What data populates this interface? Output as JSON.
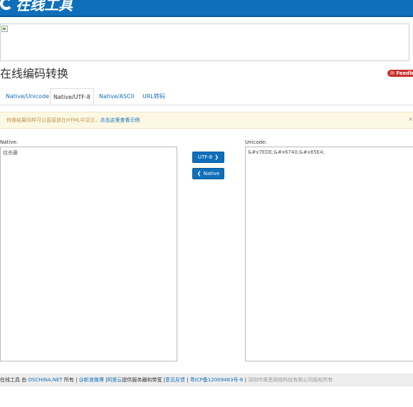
{
  "header": {
    "logo_text": "在线工具"
  },
  "page_title": "在线编码转换",
  "feedback_label": "Feedba",
  "tabs": [
    {
      "label": "Native/Unicode",
      "active": false
    },
    {
      "label": "Native/UTF-8",
      "active": true
    },
    {
      "label": "Native/ASCII",
      "active": false
    },
    {
      "label": "URL转码",
      "active": false
    }
  ],
  "notice": {
    "text": "转换结果同样可以直接放在HTML中显示，",
    "link": "点击这里查看示例",
    "close": "×"
  },
  "native": {
    "label": "Native:",
    "value": "纹杀藤"
  },
  "unicode": {
    "label": "Unicode:",
    "value": "&#x7EDE;&#x6740;&#x85E4;"
  },
  "buttons": {
    "to_utf8": "UTF-8",
    "to_native": "Native"
  },
  "footer": {
    "prefix": "在线工具 由 ",
    "oschina": "OSCHINA.NET",
    "owned": " 所有 | ",
    "weibo": "@新浪微博",
    "sep1": " |",
    "aliyun": "阿里云",
    "service": "提供服务器和带宽 |",
    "feedback": "意见反馈",
    "sep2": " | ",
    "icp": "粤ICP备12009483号-6",
    "sep3": " | ",
    "copyright": "深圳市奥思网络科技有限公司版权所有"
  },
  "colors": {
    "brand": "#0f6fba",
    "notice_bg": "#fcf8e3",
    "feedback": "#c9302c"
  }
}
